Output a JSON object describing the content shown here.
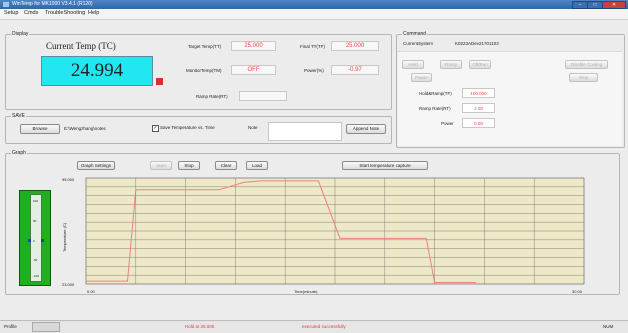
{
  "window": {
    "title": "WinTemp for MK1000 V3.4.1 (R120)",
    "minimize": "–",
    "maximize": "□",
    "close": "✕"
  },
  "menu": [
    "Setup",
    "Cmds",
    "TroubleShooting",
    "Help"
  ],
  "display": {
    "group_label": "Display",
    "current_temp_label": "Current Temp (TC)",
    "current_temp_value": "24.994",
    "target_temp_label": "Target Temp(TT)",
    "target_temp_value": "25.000",
    "final_temp_label": "Final TT(TF)",
    "final_temp_value": "25.000",
    "monitor_temp_label": "MonitorTemp(TM)",
    "monitor_temp_value": "OFF",
    "power_label": "Power(%)",
    "power_value": "-0.97",
    "ramp_rate_label": "Ramp Rate(RT)",
    "ramp_rate_value": ""
  },
  "command": {
    "group_label": "Command",
    "current_system_label": "CurrentSystem",
    "current_system_value": "K0223ADev21701103",
    "buttons_row1": [
      "Hold",
      "Ramp",
      "Off/Run"
    ],
    "pause": "Pause",
    "disable_cooling": "Disable Cooling",
    "stop": "Stop",
    "hold_ramp_label": "Hold&Ramp(TF)",
    "hold_ramp_value": "100.000",
    "ramp_rate_label": "Ramp Rate(RT)",
    "ramp_rate_value": "2.00",
    "power_label": "Power",
    "power_value": "0.00"
  },
  "save": {
    "group_label": "SAVE",
    "browse": "Browse",
    "path": "E:\\Wengzhang\\notes",
    "checkbox_label": "Save Temperature vs. Time",
    "note_label": "Note",
    "append_note": "Append Note"
  },
  "graph": {
    "group_label": "Graph",
    "buttons": [
      "Graph Settings",
      "Start",
      "Stop",
      "Clear",
      "Load"
    ],
    "capture_button": "Start temperature capture",
    "gauge_ticks": [
      "100",
      "50",
      "0",
      "-50",
      "-100"
    ]
  },
  "chart_data": {
    "type": "line",
    "ylabel": "Temperature (C)",
    "xlabel": "Time(minute)",
    "y_top_label": "95.000",
    "y_bottom_label": "23.000",
    "x_left_label": "0.00",
    "x_right_label": "30.00",
    "xlim": [
      0,
      30
    ],
    "ylim": [
      23,
      95
    ],
    "grid": true,
    "line_color": "#f08080",
    "plot_bg": "#ede8c8",
    "series": [
      {
        "x": [
          0,
          2.5,
          3,
          8,
          9.5,
          10.5,
          13.5,
          14,
          15.3,
          16.2,
          17.5,
          20.5,
          21.0,
          23.5
        ],
        "y": [
          25,
          25,
          87,
          87,
          92,
          93,
          93,
          93,
          54,
          54,
          54,
          54,
          24,
          24
        ]
      }
    ]
  },
  "status": {
    "profile": "Profile",
    "message1": "Hold at 25.000",
    "message2": "executed successfully",
    "num": "NUM"
  }
}
